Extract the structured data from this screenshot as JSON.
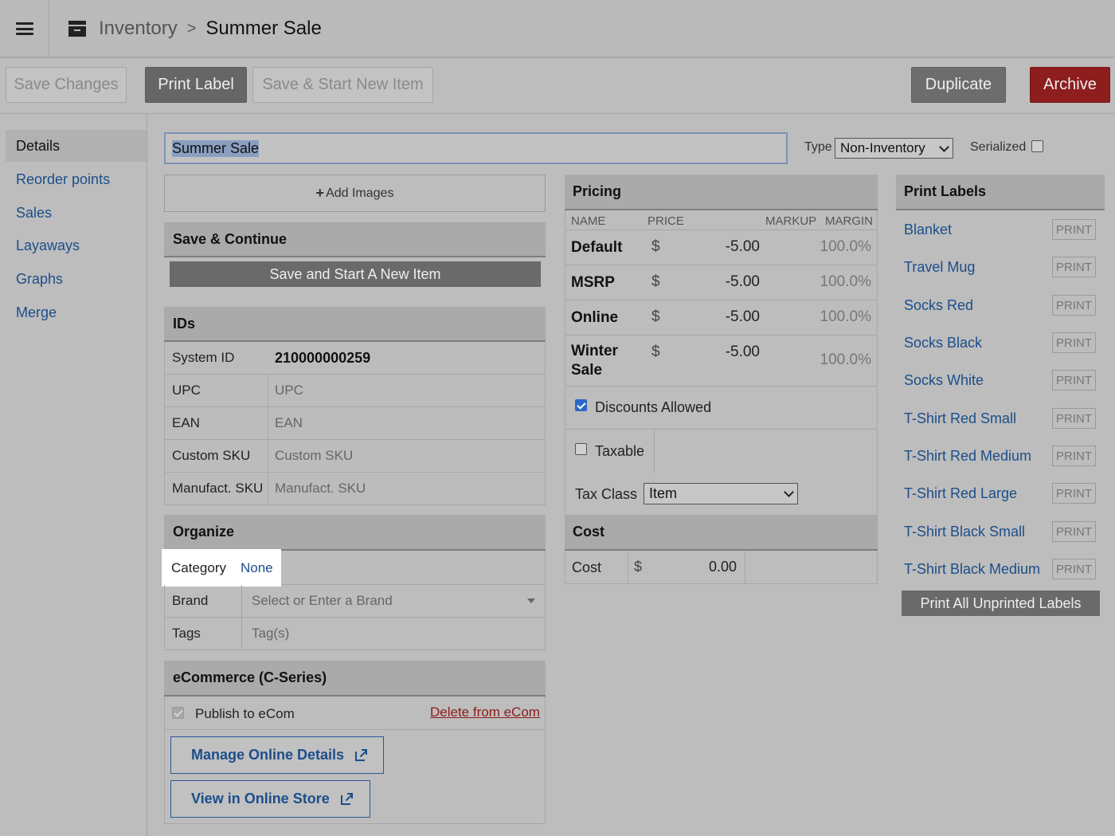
{
  "breadcrumb": {
    "parent": "Inventory",
    "separator": ">",
    "current": "Summer Sale"
  },
  "toolbar": {
    "save_changes": "Save Changes",
    "print_label": "Print Label",
    "save_start_new": "Save & Start New Item",
    "duplicate": "Duplicate",
    "archive": "Archive"
  },
  "sidebar": {
    "items": [
      {
        "label": "Details"
      },
      {
        "label": "Reorder points"
      },
      {
        "label": "Sales"
      },
      {
        "label": "Layaways"
      },
      {
        "label": "Graphs"
      },
      {
        "label": "Merge"
      }
    ]
  },
  "item": {
    "name": "Summer Sale",
    "type_label": "Type",
    "type_value": "Non-Inventory",
    "serialized_label": "Serialized",
    "serialized": false
  },
  "add_images": "Add Images",
  "save_continue": {
    "title": "Save & Continue",
    "button": "Save and Start A New Item"
  },
  "ids": {
    "title": "IDs",
    "system_id_label": "System ID",
    "system_id": "210000000259",
    "upc_label": "UPC",
    "upc_placeholder": "UPC",
    "ean_label": "EAN",
    "ean_placeholder": "EAN",
    "custom_sku_label": "Custom SKU",
    "custom_sku_placeholder": "Custom SKU",
    "manufact_sku_label": "Manufact. SKU",
    "manufact_sku_placeholder": "Manufact. SKU"
  },
  "organize": {
    "title": "Organize",
    "category_label": "Category",
    "category_value": "None",
    "brand_label": "Brand",
    "brand_placeholder": "Select or Enter a Brand",
    "tags_label": "Tags",
    "tags_placeholder": "Tag(s)"
  },
  "ecommerce": {
    "title": "eCommerce (C-Series)",
    "publish_label": "Publish to eCom",
    "delete_link": "Delete from eCom",
    "manage_button": "Manage Online Details",
    "view_button": "View in Online Store"
  },
  "pricing": {
    "title": "Pricing",
    "columns": {
      "name": "NAME",
      "price": "PRICE",
      "markup": "MARKUP",
      "margin": "MARGIN"
    },
    "currency": "$",
    "rows": [
      {
        "name": "Default",
        "price": "-5.00",
        "margin": "100.0%"
      },
      {
        "name": "MSRP",
        "price": "-5.00",
        "margin": "100.0%"
      },
      {
        "name": "Online",
        "price": "-5.00",
        "margin": "100.0%"
      },
      {
        "name_line1": "Winter",
        "name_line2": "Sale",
        "price": "-5.00",
        "margin": "100.0%"
      }
    ],
    "discounts_label": "Discounts Allowed",
    "discounts_allowed": true,
    "taxable_label": "Taxable",
    "taxable": false,
    "tax_class_label": "Tax Class",
    "tax_class_value": "Item"
  },
  "cost": {
    "title": "Cost",
    "label": "Cost",
    "currency": "$",
    "value": "0.00"
  },
  "print_labels": {
    "title": "Print Labels",
    "print_button": "PRINT",
    "items": [
      "Blanket",
      "Travel Mug",
      "Socks Red",
      "Socks Black",
      "Socks White",
      "T-Shirt Red Small",
      "T-Shirt Red Medium",
      "T-Shirt Red Large",
      "T-Shirt Black Small",
      "T-Shirt Black Medium"
    ],
    "print_all_button": "Print All Unprinted Labels"
  },
  "colors": {
    "accent_link": "#1c4e8a",
    "archive": "#8e1d1d",
    "checkbox": "#2d67c9"
  }
}
